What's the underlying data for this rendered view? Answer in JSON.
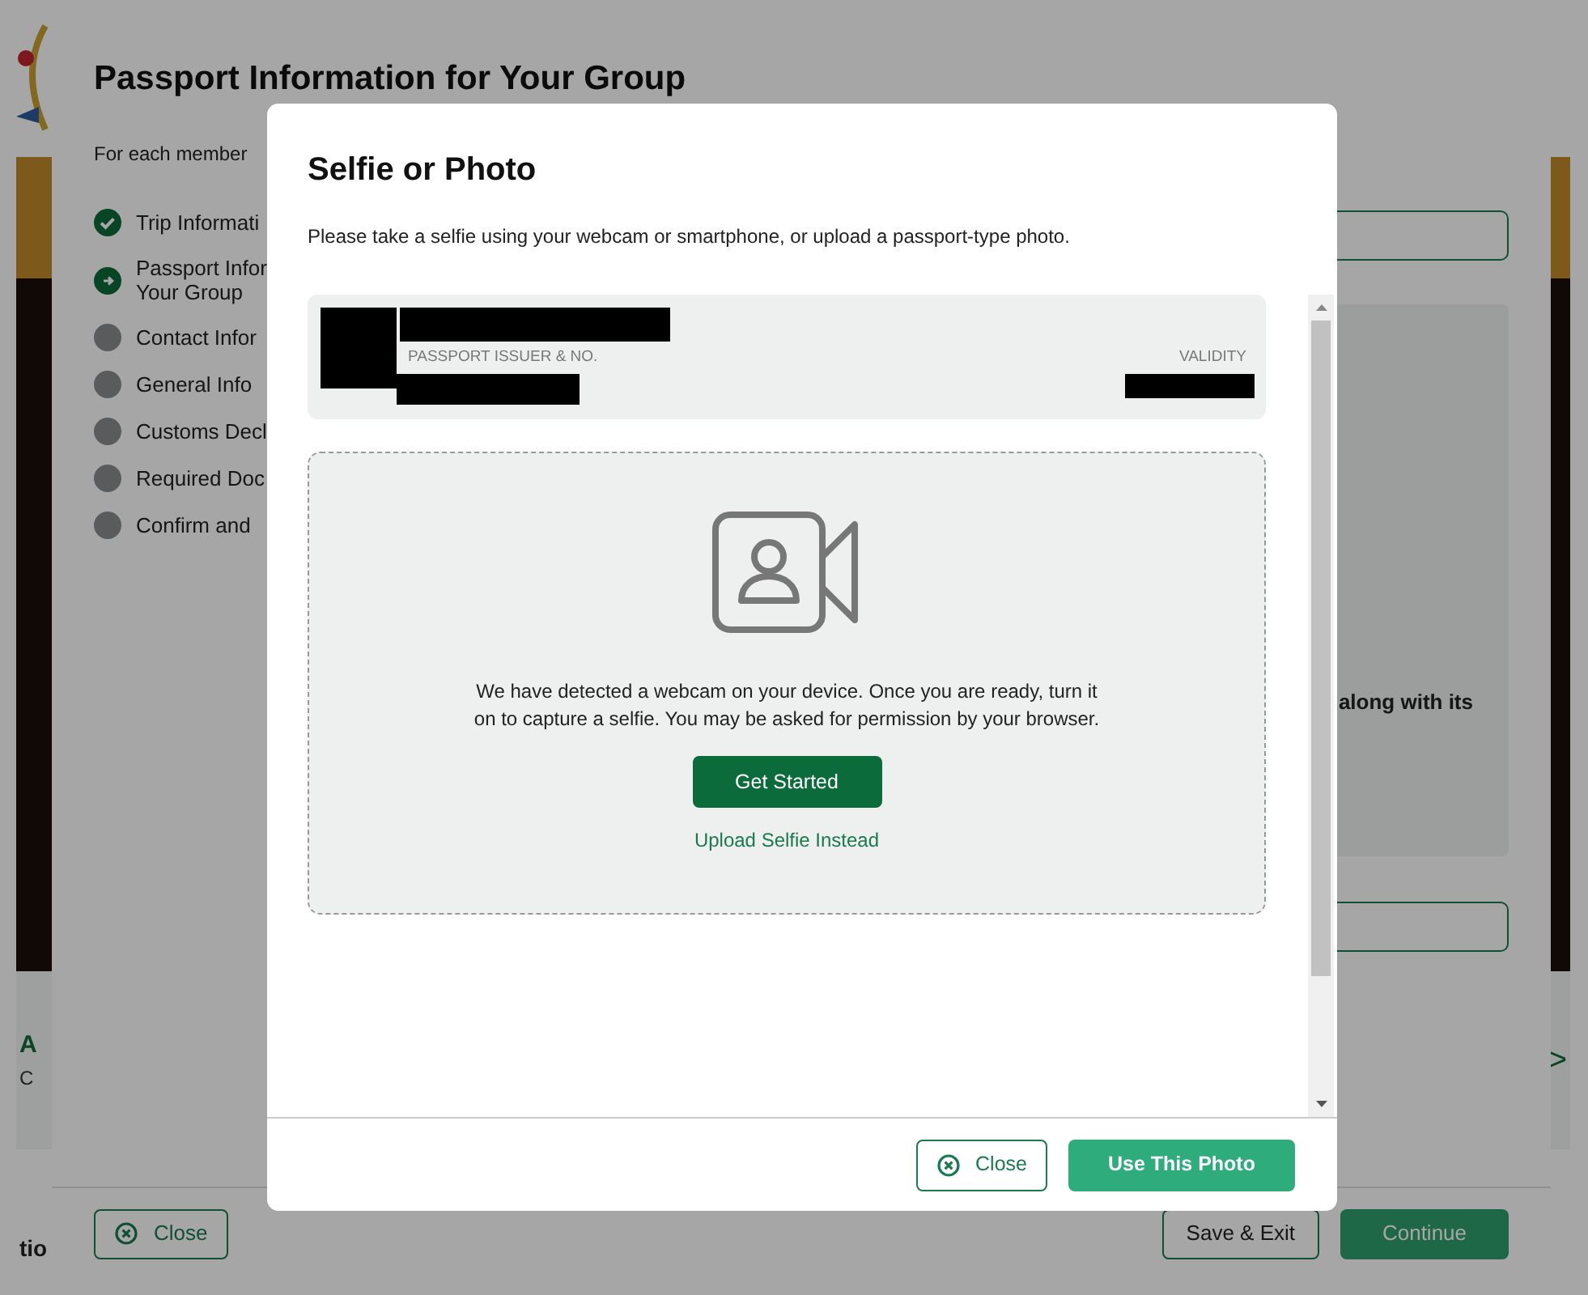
{
  "page": {
    "title": "Passport Information for Your Group",
    "subtitle": "For each member",
    "side_fragments": [
      "A",
      "C"
    ],
    "side_arrow": ">",
    "bottom_fragment": "tio",
    "right_text": "along with its",
    "steps": [
      {
        "label": "Trip Informati",
        "kind": "done"
      },
      {
        "label": "Passport Infor\nYour Group",
        "kind": "current"
      },
      {
        "label": "Contact Infor",
        "kind": "pending"
      },
      {
        "label": "General Info",
        "kind": "pending"
      },
      {
        "label": "Customs Decl",
        "kind": "pending"
      },
      {
        "label": "Required Doc",
        "kind": "pending"
      },
      {
        "label": "Confirm and",
        "kind": "pending"
      }
    ],
    "buttons": {
      "close": "Close",
      "save": "Save & Exit",
      "continue": "Continue"
    }
  },
  "dialog": {
    "title": "Selfie or Photo",
    "instructions": "Please take a selfie using your webcam or smartphone, or upload a passport-type photo.",
    "passport": {
      "issuer_label": "PASSPORT ISSUER & NO.",
      "validity_label": "VALIDITY"
    },
    "webcam_message": "We have detected a webcam on your device. Once you are ready, turn it on to capture a selfie. You may be asked for permission by your browser.",
    "start_button": "Get Started",
    "upload_link": "Upload Selfie Instead",
    "close_button": "Close",
    "use_button": "Use This Photo"
  }
}
